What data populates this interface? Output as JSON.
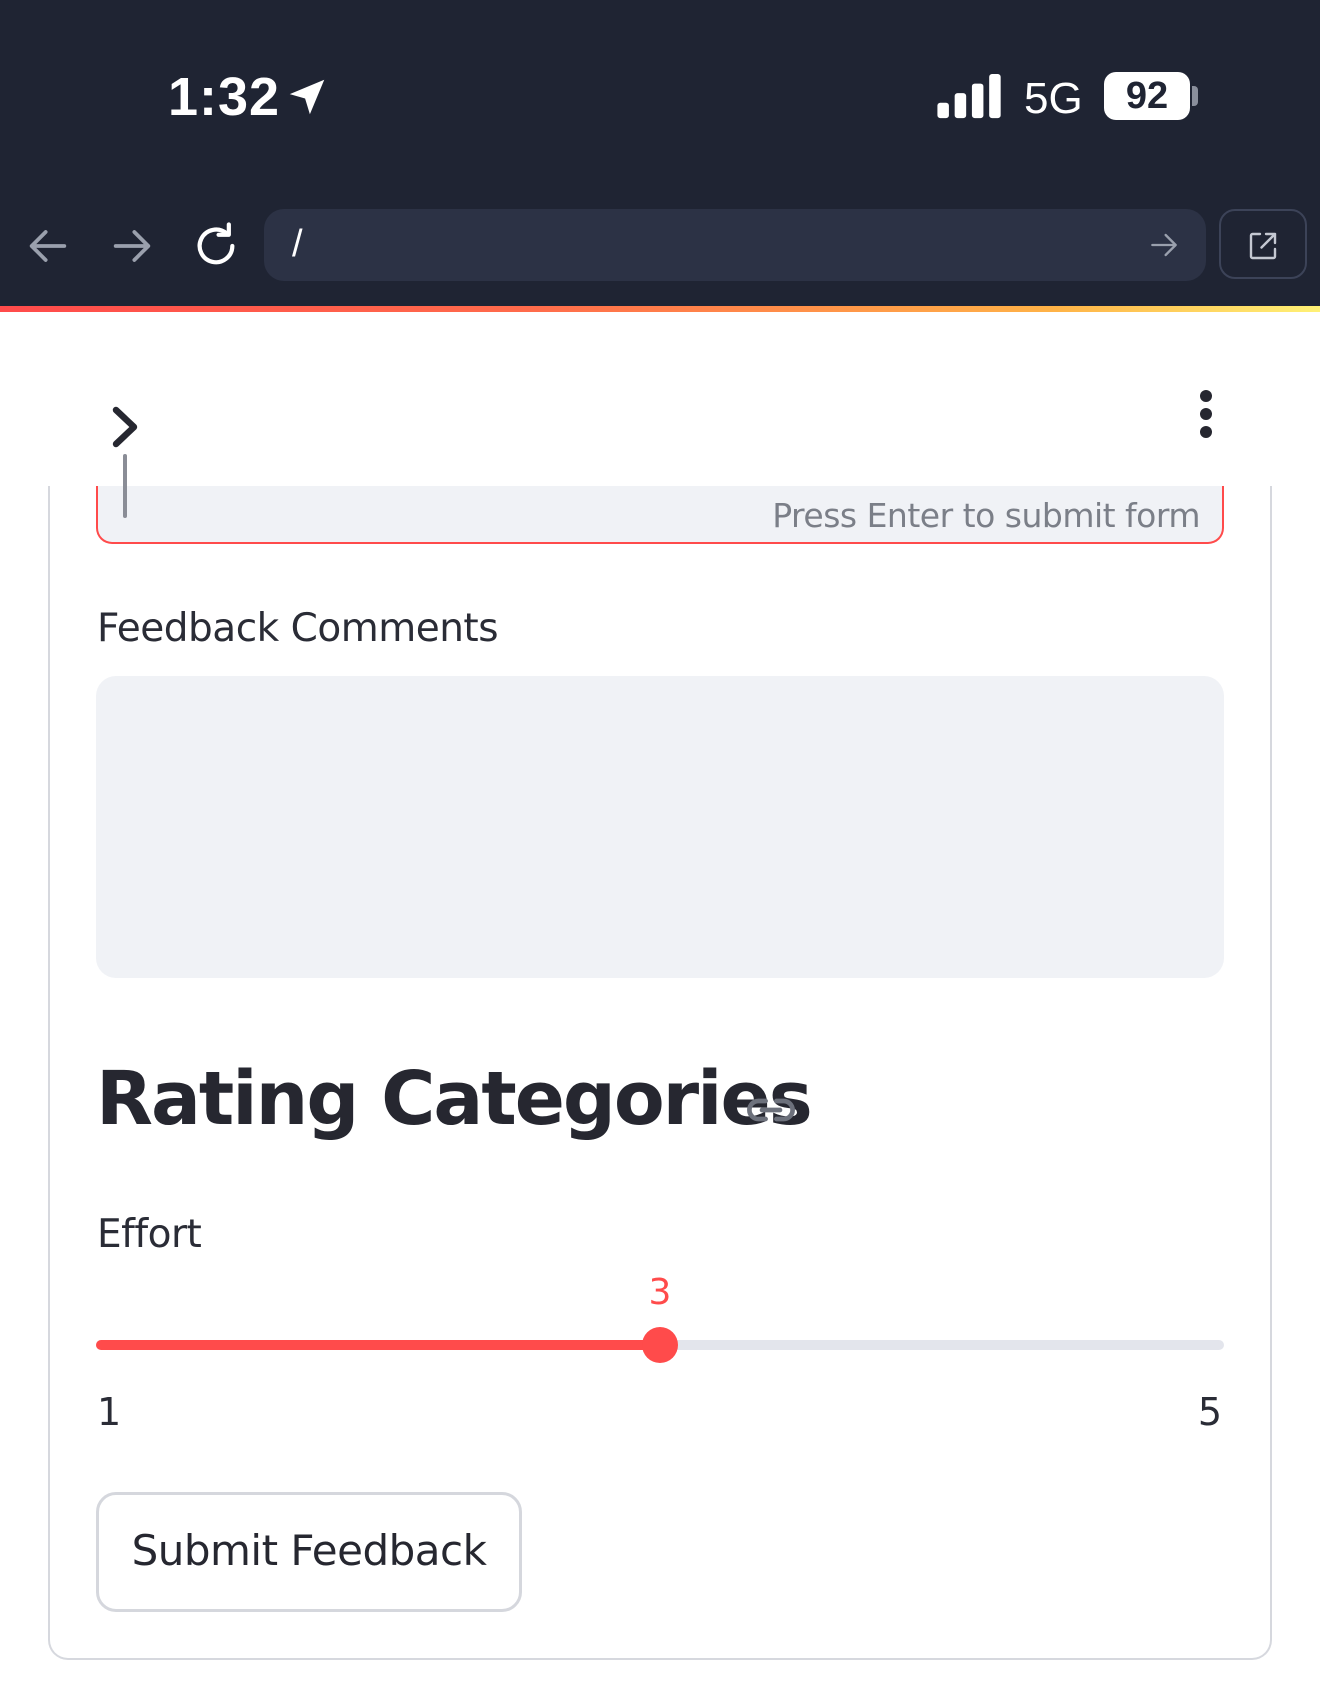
{
  "status_bar": {
    "time": "1:32",
    "location_icon": "location-arrow-icon",
    "signal_icon": "cellular-signal-icon",
    "network": "5G",
    "battery": "92"
  },
  "browser": {
    "back_icon": "arrow-left-icon",
    "forward_icon": "arrow-right-icon",
    "reload_icon": "reload-icon",
    "url": "/",
    "go_icon": "arrow-right-icon",
    "external_icon": "external-link-icon"
  },
  "app_header": {
    "sidebar_icon": "chevron-right-icon",
    "menu_icon": "vertical-ellipsis-icon"
  },
  "form": {
    "input_hint": "Press Enter to submit form",
    "comments_label": "Feedback Comments",
    "comments_value": "",
    "section_heading": "Rating Categories",
    "anchor_icon": "link-icon",
    "effort": {
      "label": "Effort",
      "value": 3,
      "min": 1,
      "max": 5,
      "value_text": "3",
      "min_text": "1",
      "max_text": "5"
    },
    "submit_label": "Submit Feedback"
  },
  "colors": {
    "chrome_bg": "#1f2433",
    "url_bar_bg": "#2c3245",
    "accent": "#ff4b4b",
    "input_bg": "#f0f2f6",
    "text": "#262730",
    "muted_text": "#7b7f88"
  }
}
